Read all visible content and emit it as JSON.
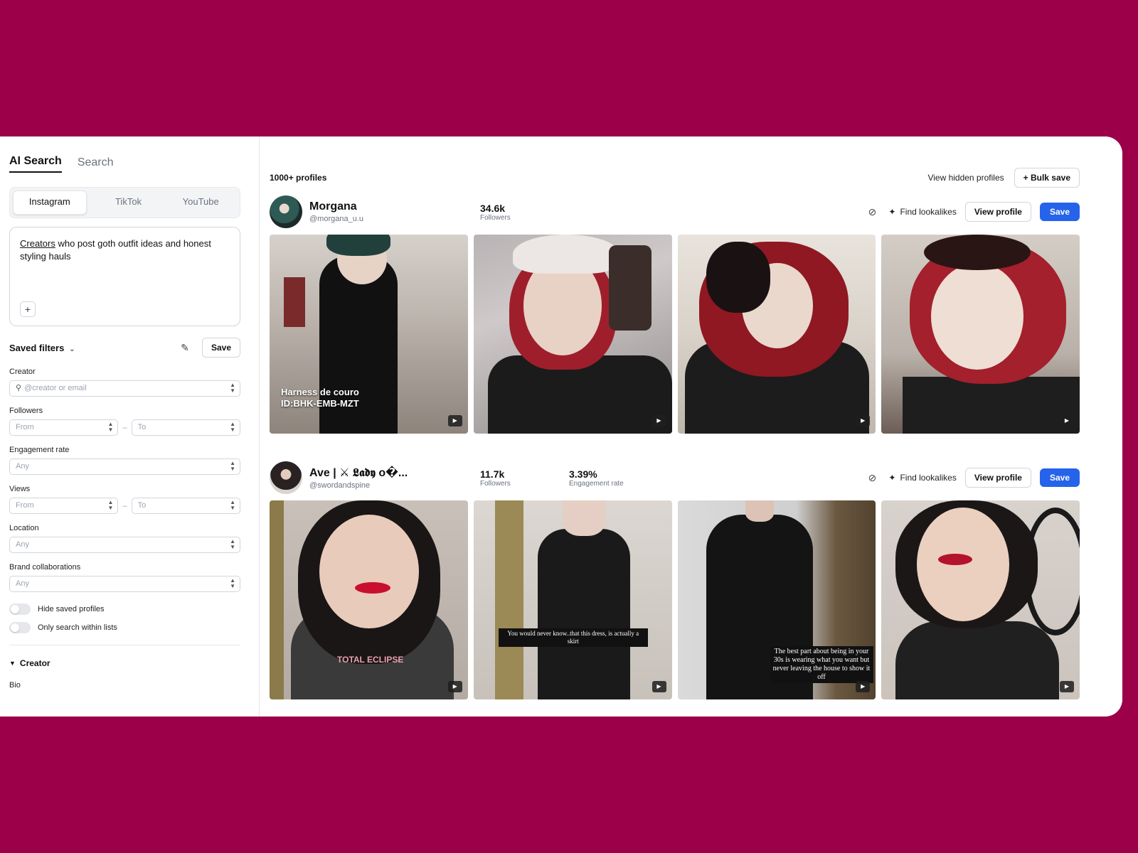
{
  "sidebar": {
    "mode_tabs": [
      "AI Search",
      "Search"
    ],
    "platform_tabs": [
      "Instagram",
      "TikTok",
      "YouTube"
    ],
    "prompt": {
      "underlined_word": "Creators",
      "rest": " who post goth outfit ideas and honest styling hauls"
    },
    "saved_filters_label": "Saved filters",
    "save_label": "Save",
    "creator": {
      "label": "Creator",
      "placeholder": "@creator or email"
    },
    "followers": {
      "label": "Followers",
      "from": "From",
      "to": "To"
    },
    "engagement": {
      "label": "Engagement rate",
      "value": "Any"
    },
    "views": {
      "label": "Views",
      "from": "From",
      "to": "To"
    },
    "location": {
      "label": "Location",
      "value": "Any"
    },
    "brand_collabs": {
      "label": "Brand collaborations",
      "value": "Any"
    },
    "toggles": [
      "Hide saved profiles",
      "Only search within lists"
    ],
    "section_title": "Creator",
    "bio_label": "Bio",
    "range_dash": "–"
  },
  "main": {
    "count": "1000+ profiles",
    "view_hidden": "View hidden profiles",
    "bulk_save": "+ Bulk save",
    "find_lookalikes": "Find lookalikes",
    "view_profile": "View profile",
    "save": "Save",
    "profiles": [
      {
        "name": "Morgana",
        "handle": "@morgana_u.u",
        "stats": [
          {
            "value": "34.6k",
            "label": "Followers"
          }
        ],
        "caption": "Harness de couro\nID:BHK-EMB-MZT"
      },
      {
        "name": "Ave | ⚔ 𝕷𝖆𝖉𝖞 o�...",
        "handle": "@swordandspine",
        "stats": [
          {
            "value": "11.7k",
            "label": "Followers"
          },
          {
            "value": "3.39%",
            "label": "Engagement rate"
          }
        ],
        "captions": [
          "TOTAL ECLIPSE",
          "You would never know..that this dress, is actually a skirt",
          "The best part about being in your 30s is wearing what you want but never leaving the house to show it off"
        ]
      }
    ]
  },
  "icons": {
    "video": "video-camera-icon",
    "hide": "eye-off-icon",
    "sparkle": "sparkle-icon",
    "pencil": "pencil-icon",
    "search": "search-icon",
    "spinner": "updown-chevron-icon"
  },
  "colors": {
    "background": "#9b0049",
    "accent": "#2563eb"
  }
}
